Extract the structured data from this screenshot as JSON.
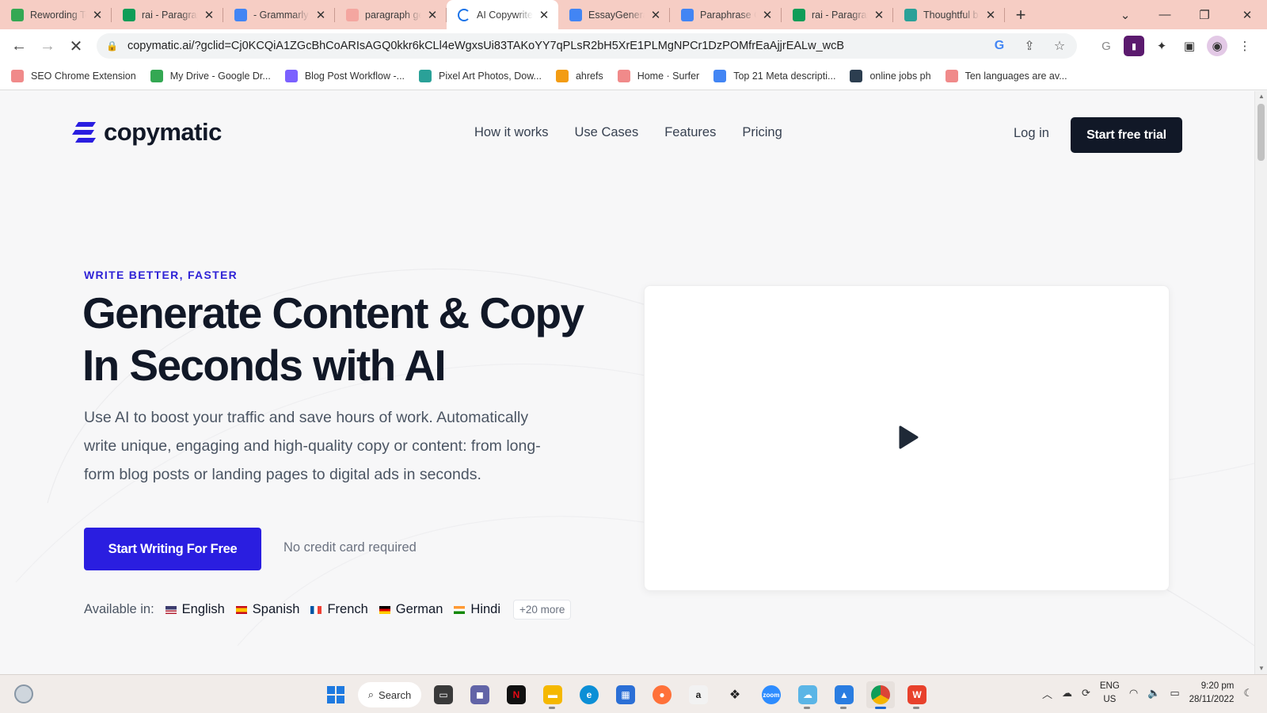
{
  "browser": {
    "tabs": [
      {
        "title": "Rewording Tool",
        "favicon": "google-drive-icon",
        "color": "#34a853",
        "active": false
      },
      {
        "title": "rai - Paragraph",
        "favicon": "google-sheets-icon",
        "color": "#0f9d58",
        "active": false
      },
      {
        "title": "- Grammarly",
        "favicon": "google-icon",
        "color": "#4285f4",
        "active": false
      },
      {
        "title": "paragraph generator",
        "favicon": "tool-icon",
        "color": "#f4a6a0",
        "active": false
      },
      {
        "title": "AI Copywriter",
        "favicon": "loading-icon",
        "color": "#1a73e8",
        "active": true
      },
      {
        "title": "EssayGenerator",
        "favicon": "google-icon",
        "color": "#4285f4",
        "active": false
      },
      {
        "title": "Paraphrase Online",
        "favicon": "google-icon",
        "color": "#4285f4",
        "active": false
      },
      {
        "title": "rai - Paragraph",
        "favicon": "google-sheets-icon",
        "color": "#0f9d58",
        "active": false
      },
      {
        "title": "Thoughtful blog",
        "favicon": "site-icon",
        "color": "#2aa198",
        "active": false
      }
    ],
    "url": "copymatic.ai/?gclid=Cj0KCQiA1ZGcBhCoARIsAGQ0kkr6kCLl4eWgxsUi83TAKoYY7qPLsR2bH5XrE1PLMgNPCr1DzPOMfrEaAjjrEALw_wcB",
    "bookmarks": [
      {
        "label": "SEO Chrome Extension",
        "color": "#f08a8a"
      },
      {
        "label": "My Drive - Google Dr...",
        "color": "#34a853"
      },
      {
        "label": "Blog Post Workflow -...",
        "color": "#7b61ff"
      },
      {
        "label": "Pixel Art Photos, Dow...",
        "color": "#2aa198"
      },
      {
        "label": "ahrefs",
        "color": "#f39c12"
      },
      {
        "label": "Home · Surfer",
        "color": "#f08a8a"
      },
      {
        "label": "Top 21 Meta descripti...",
        "color": "#4285f4"
      },
      {
        "label": "online jobs ph",
        "color": "#2c3e50"
      },
      {
        "label": "Ten languages are av...",
        "color": "#f08a8a"
      }
    ]
  },
  "site": {
    "brand": "copymatic",
    "accent": "#2a1ee0",
    "nav": [
      "How it works",
      "Use Cases",
      "Features",
      "Pricing"
    ],
    "login": "Log in",
    "trial": "Start free trial",
    "hero": {
      "eyebrow": "WRITE BETTER, FASTER",
      "headline_line1": "Generate Content & Copy",
      "headline_line2": "In Seconds with AI",
      "lead": "Use AI to boost your traffic and save hours of work. Automatically write unique, engaging and high-quality copy or content: from long-form blog posts or landing pages to digital ads in seconds.",
      "cta": "Start Writing For Free",
      "cta_note": "No credit card required",
      "available_label": "Available in:",
      "languages": [
        "English",
        "Spanish",
        "French",
        "German",
        "Hindi"
      ],
      "more": "+20 more"
    }
  },
  "taskbar": {
    "search_label": "Search",
    "language": "ENG",
    "region": "US",
    "time": "9:20 pm",
    "date": "28/11/2022"
  }
}
